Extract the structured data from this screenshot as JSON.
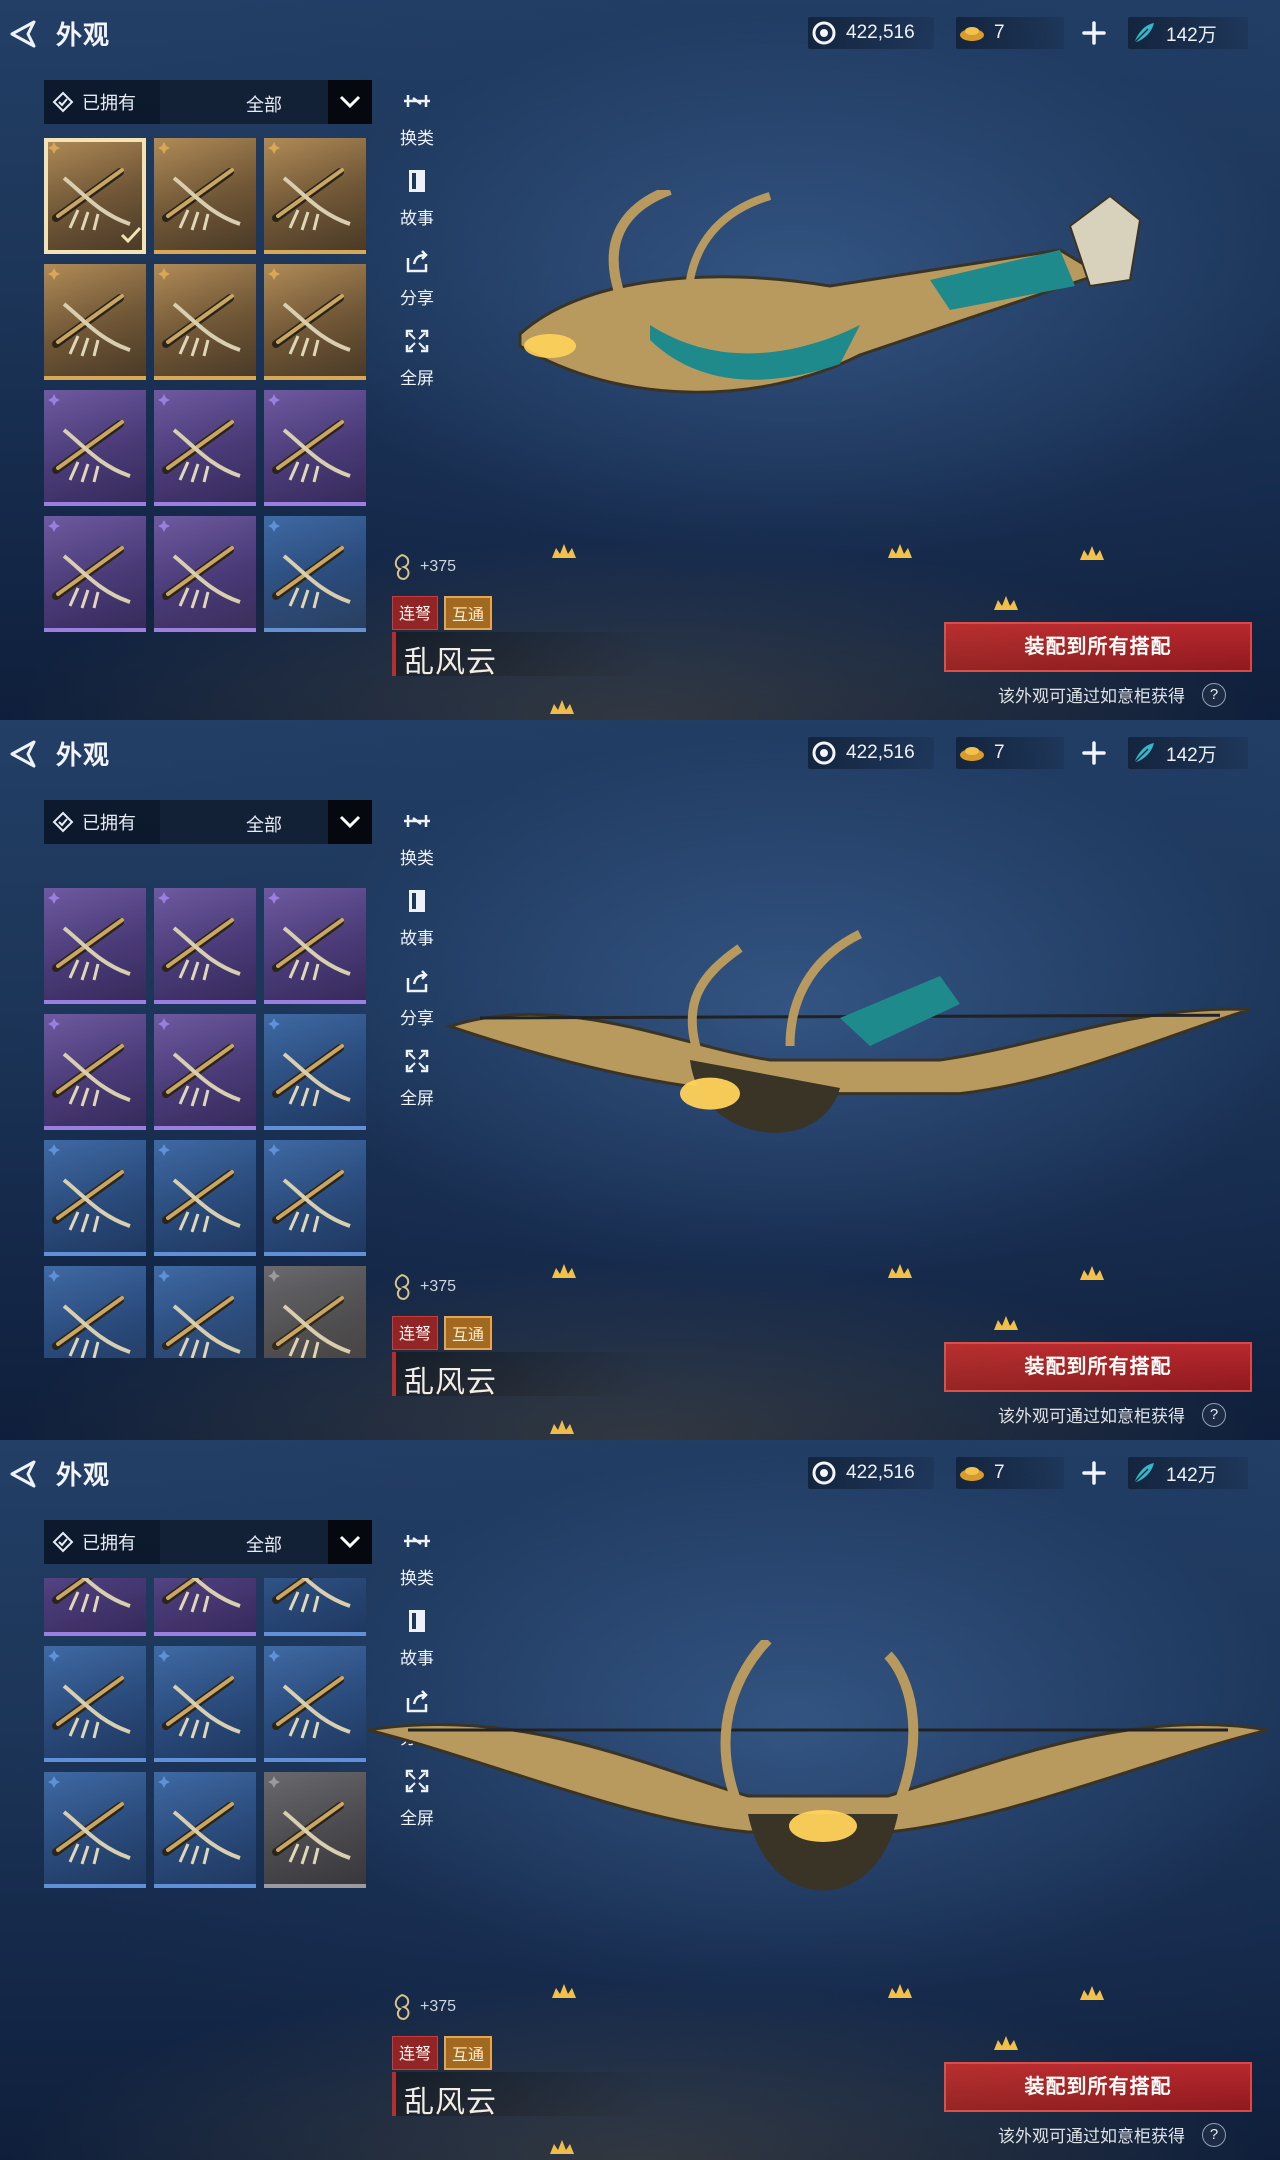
{
  "header": {
    "title": "外观",
    "currency_coins": "422,516",
    "currency_ingot": "7",
    "currency_jade": "142万"
  },
  "filter": {
    "owned_label": "已拥有",
    "category": "全部"
  },
  "actions": {
    "switch": "换类",
    "story": "故事",
    "share": "分享",
    "fullscreen": "全屏"
  },
  "item": {
    "power": "+375",
    "tag1": "连弩",
    "tag2": "互通",
    "name": "乱风云"
  },
  "equip_label": "装配到所有搭配",
  "hint": "该外观可通过如意柜获得",
  "help_label": "?",
  "grid_pages": [
    [
      {
        "rarity": "gold",
        "selected": true
      },
      {
        "rarity": "gold"
      },
      {
        "rarity": "gold"
      },
      {
        "rarity": "gold"
      },
      {
        "rarity": "gold"
      },
      {
        "rarity": "gold"
      },
      {
        "rarity": "purple"
      },
      {
        "rarity": "purple"
      },
      {
        "rarity": "purple"
      },
      {
        "rarity": "purple"
      },
      {
        "rarity": "purple"
      },
      {
        "rarity": "blue"
      }
    ],
    [
      {
        "rarity": "purple"
      },
      {
        "rarity": "purple"
      },
      {
        "rarity": "purple"
      },
      {
        "rarity": "purple"
      },
      {
        "rarity": "purple"
      },
      {
        "rarity": "blue"
      },
      {
        "rarity": "blue"
      },
      {
        "rarity": "blue"
      },
      {
        "rarity": "blue"
      },
      {
        "rarity": "blue"
      },
      {
        "rarity": "blue"
      },
      {
        "rarity": "gray"
      }
    ],
    [
      {
        "rarity": "purple"
      },
      {
        "rarity": "purple"
      },
      {
        "rarity": "blue"
      },
      {
        "rarity": "blue"
      },
      {
        "rarity": "blue"
      },
      {
        "rarity": "blue"
      },
      {
        "rarity": "blue"
      },
      {
        "rarity": "blue"
      },
      {
        "rarity": "gray"
      }
    ]
  ],
  "colors": {
    "gold": "#d9a856",
    "purple": "#9b7fe0",
    "blue": "#5f90d8",
    "gray": "#9a9aa0",
    "accent_red": "#b8282d"
  }
}
